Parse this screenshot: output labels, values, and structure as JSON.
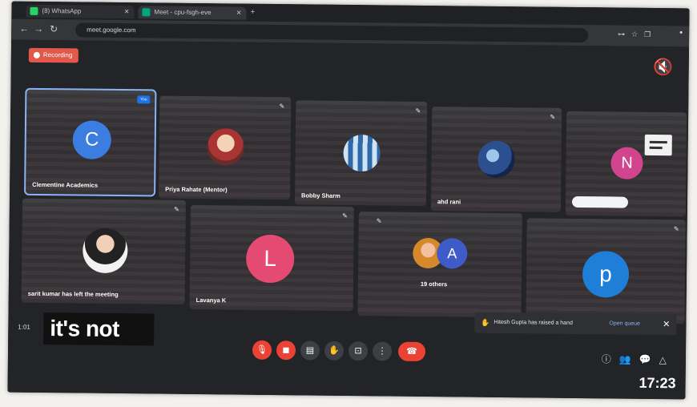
{
  "browser": {
    "tabs": [
      {
        "label": "(8) WhatsApp"
      },
      {
        "label": "Meet - cpu-fsgh-eve"
      }
    ],
    "new_tab_icon": "plus-icon",
    "url": "meet.google.com"
  },
  "meeting": {
    "recording_label": "Recording",
    "pin_badge": "You",
    "tiles": [
      {
        "name": "Clementine Academics",
        "initial": "C",
        "color": "#3b7de0",
        "active": true
      },
      {
        "name": "Priya Rahate (Mentor)",
        "photo": true
      },
      {
        "name": "Bobby Sharm",
        "photo": true
      },
      {
        "name": "ahd rani",
        "photo": true
      },
      {
        "name": "",
        "initial": "N",
        "color": "#d2448e"
      },
      {
        "name": "sarit kumar has left the meeting",
        "photo": true
      },
      {
        "name": "Lavanya K",
        "initial": "L",
        "color": "#e54b72"
      },
      {
        "name": "19 others",
        "initial": "A",
        "color": "#3f5bc9"
      },
      {
        "name": "",
        "initial": "p",
        "color": "#1f7ed8"
      }
    ],
    "subtitle": "it's not",
    "time_left": "1:01",
    "toast": {
      "text": "Hitesh Gupta has raised a hand",
      "action": "Open queue"
    },
    "clock": "17:23",
    "colors": {
      "accent": "#8ab4f8",
      "danger": "#ea4335"
    }
  }
}
